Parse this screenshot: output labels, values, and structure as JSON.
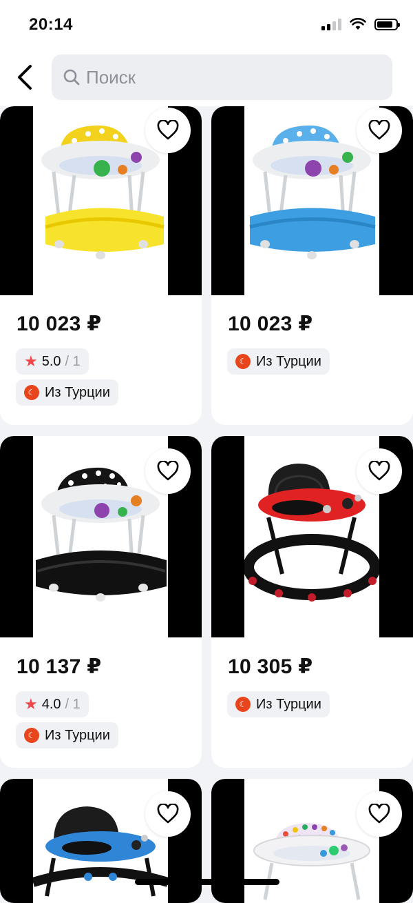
{
  "status_bar": {
    "time": "20:14"
  },
  "search": {
    "placeholder": "Поиск"
  },
  "products": [
    {
      "price": "10 023 ₽",
      "rating": "5.0",
      "reviews": "/ 1",
      "origin": "Из Турции",
      "seat_color": "#f2d21d",
      "base_color": "#f7e32b"
    },
    {
      "price": "10 023 ₽",
      "origin": "Из Турции",
      "seat_color": "#5ab0ea",
      "base_color": "#3d9fe2"
    },
    {
      "price": "10 137 ₽",
      "rating": "4.0",
      "reviews": "/ 1",
      "origin": "Из Турции",
      "seat_color": "#151515",
      "base_color": "#111111"
    },
    {
      "price": "10 305 ₽",
      "origin": "Из Турции",
      "seat_color": "#1d1d1d",
      "base_color": "#111111",
      "tray_color": "#e02222"
    },
    {
      "seat_color": "#1c1c1c",
      "tray_color": "#2f86d6"
    },
    {
      "seat_color": "#c9b3e0",
      "tray_color": "#ffffff"
    }
  ],
  "icons": {
    "favorite": "heart-icon",
    "back": "chevron-left-icon",
    "search": "search-icon",
    "rating": "star-icon",
    "origin": "turkey-flag-icon"
  },
  "colors": {
    "star": "#f0484a",
    "flag": "#e9451d",
    "chip_bg": "#f0f1f4"
  }
}
